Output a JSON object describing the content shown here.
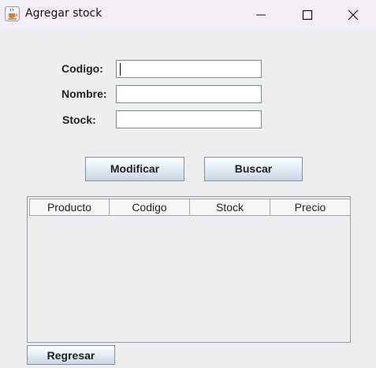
{
  "window": {
    "title": "Agregar stock",
    "icon": "java-cup-icon",
    "controls": [
      "minimize-icon",
      "maximize-icon",
      "close-icon"
    ]
  },
  "form": {
    "codigo_label": "Codigo:",
    "codigo_value": "",
    "nombre_label": "Nombre:",
    "nombre_value": "",
    "stock_label": "Stock:",
    "stock_value": ""
  },
  "buttons": {
    "modificar": "Modificar",
    "buscar": "Buscar",
    "regresar": "Regresar"
  },
  "table": {
    "columns": [
      "Producto",
      "Codigo",
      "Stock",
      "Precio"
    ],
    "rows": []
  }
}
